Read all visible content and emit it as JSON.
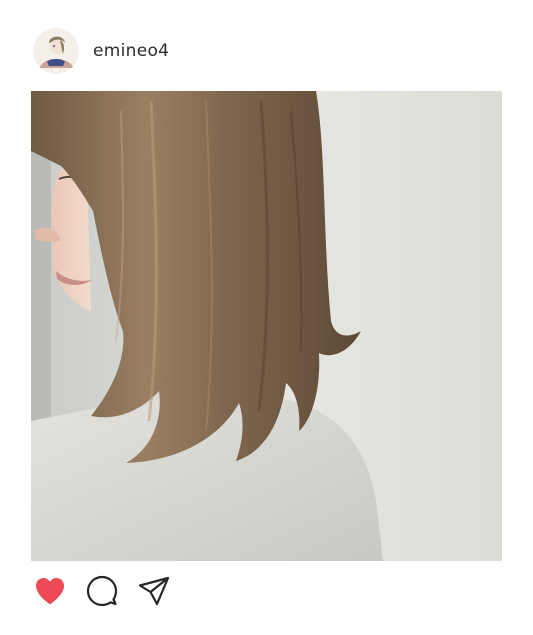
{
  "post": {
    "username": "emineo4",
    "liked": true
  },
  "icons": {
    "like": "heart-icon",
    "comment": "comment-bubble-icon",
    "share": "paper-plane-icon"
  },
  "colors": {
    "like_active": "#ed4956",
    "text": "#2b2b2b",
    "icon_stroke": "#262626"
  }
}
